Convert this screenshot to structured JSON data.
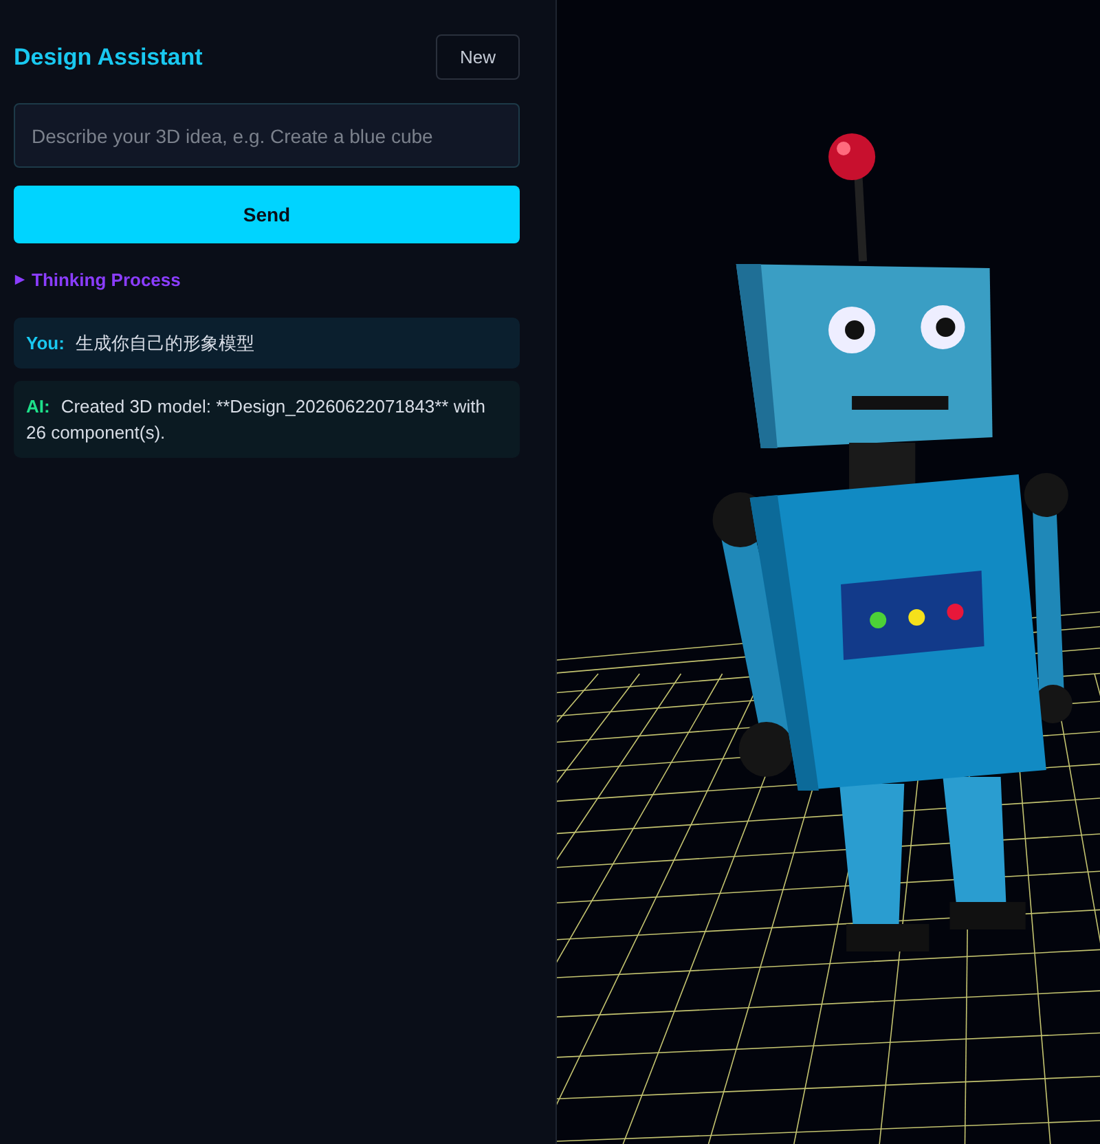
{
  "panel": {
    "title": "Design Assistant",
    "new_button": "New",
    "prompt": {
      "placeholder": "Describe your 3D idea, e.g. Create a blue cube"
    },
    "send_button": "Send",
    "thinking": {
      "label": "Thinking Process",
      "expanded": false
    }
  },
  "messages": [
    {
      "kind": "user",
      "speaker": "You:",
      "text": "生成你自己的形象模型"
    },
    {
      "kind": "ai",
      "speaker": "AI:",
      "text": "Created 3D model: **Design_20260622071843** with 26 component(s)."
    }
  ]
}
